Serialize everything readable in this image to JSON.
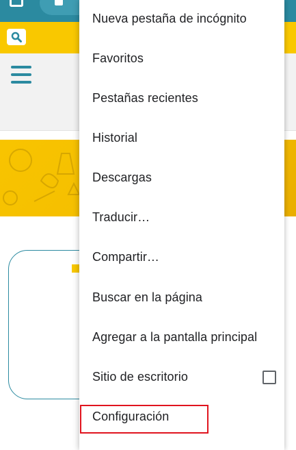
{
  "menu": {
    "items": [
      {
        "label": "Nueva pestaña de incógnito"
      },
      {
        "label": "Favoritos"
      },
      {
        "label": "Pestañas recientes"
      },
      {
        "label": "Historial"
      },
      {
        "label": "Descargas"
      },
      {
        "label": "Traducir…"
      },
      {
        "label": "Compartir…"
      },
      {
        "label": "Buscar en la página"
      },
      {
        "label": "Agregar a la pantalla principal"
      },
      {
        "label": "Sitio de escritorio",
        "checkbox_checked": false
      },
      {
        "label": "Configuración",
        "highlighted": true
      }
    ]
  },
  "colors": {
    "brand_teal": "#2b8aa0",
    "brand_yellow": "#f9c800",
    "highlight_red": "#e0141e"
  },
  "icons": {
    "search": "search-icon",
    "menu": "hamburger-menu-icon"
  }
}
